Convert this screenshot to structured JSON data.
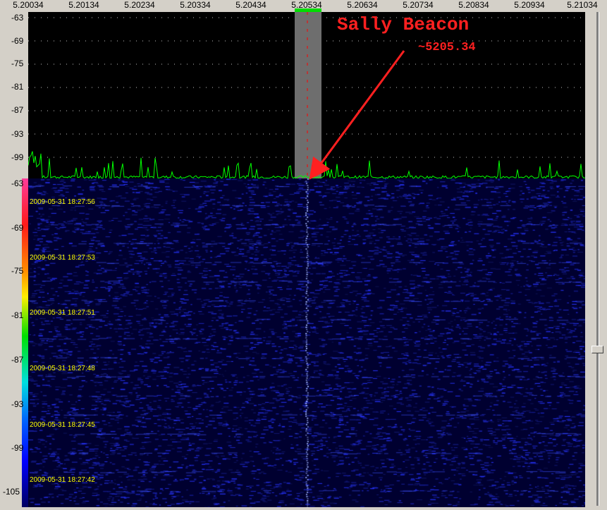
{
  "freq_axis": {
    "ticks": [
      "5.20034",
      "5.20134",
      "5.20234",
      "5.20334",
      "5.20434",
      "5.20534",
      "5.20634",
      "5.20734",
      "5.20834",
      "5.20934",
      "5.21034"
    ]
  },
  "spectrum": {
    "y_ticks": [
      "-63",
      "-69",
      "-75",
      "-81",
      "-87",
      "-93",
      "-99"
    ],
    "trace_color": "#00ff00",
    "selection_color": "#707070"
  },
  "waterfall": {
    "y_ticks": [
      "-63",
      "-69",
      "-75",
      "-81",
      "-87",
      "-93",
      "-99",
      "-105"
    ],
    "timestamps": [
      "2009-05-31 18:27:56",
      "2009-05-31 18:27:53",
      "2009-05-31 18:27:51",
      "2009-05-31 18:27:48",
      "2009-05-31 18:27:45",
      "2009-05-31 18:27:42"
    ]
  },
  "annotation": {
    "title": "Sally Beacon",
    "freq": "~5205.34",
    "color": "#ff2020"
  },
  "scrollbar": {
    "position": 0.68
  }
}
